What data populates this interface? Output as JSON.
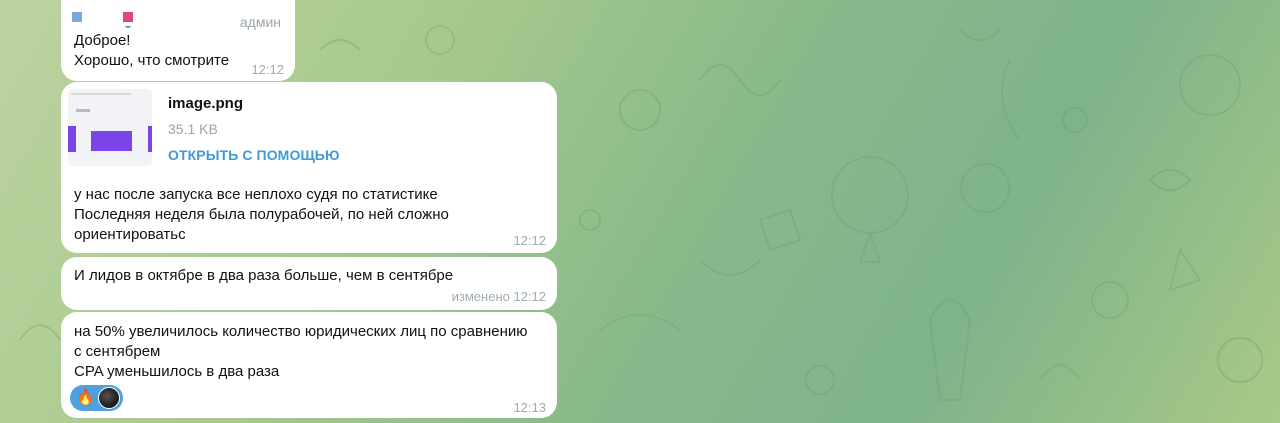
{
  "messages": [
    {
      "role_label": "админ",
      "lines": [
        "Доброе!",
        "Хорошо, что смотрите"
      ],
      "time": "12:12"
    },
    {
      "file": {
        "name": "image.png",
        "size": "35.1 KB",
        "open_label": "ОТКРЫТЬ С ПОМОЩЬЮ"
      },
      "lines": [
        "у нас после запуска все неплохо судя по статистике",
        "Последняя неделя была полурабочей, по ней сложно",
        "ориентироватьс"
      ],
      "time": "12:12"
    },
    {
      "lines": [
        "И лидов в октябре в два раза больше, чем в сентябре"
      ],
      "time": "изменено 12:12"
    },
    {
      "lines": [
        "на 50% увеличилось количество юридических лиц по сравнению",
        "с сентябрем",
        "CPA уменьшилось в два раза"
      ],
      "reaction": {
        "emoji": "🔥",
        "icon": "fire-icon"
      },
      "time": "12:13"
    }
  ],
  "colors": {
    "accent_link": "#3f9ad6",
    "reaction_bg": "#4ea0df",
    "timestamp": "#a0acb6"
  }
}
